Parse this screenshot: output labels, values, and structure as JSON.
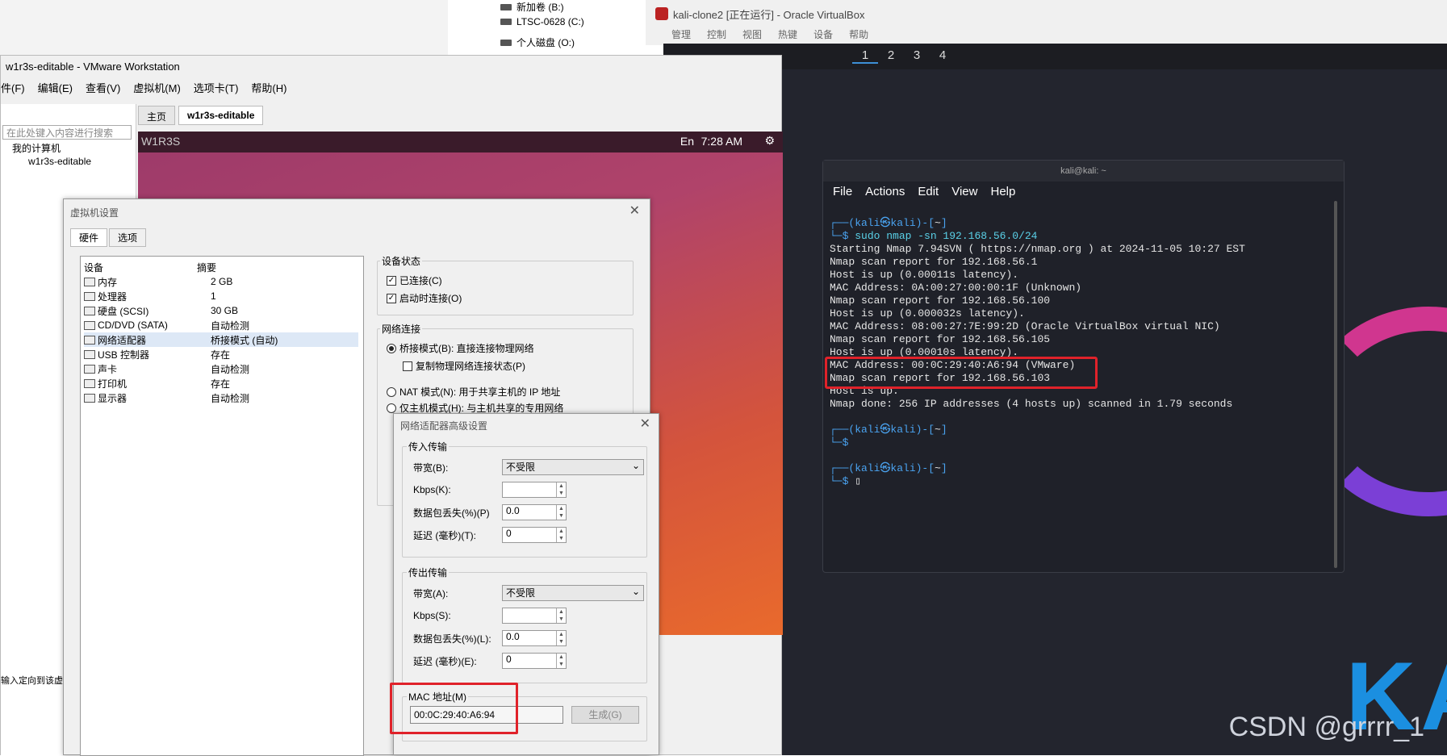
{
  "explorer": {
    "drives": [
      {
        "label": "新加卷 (B:)"
      },
      {
        "label": "LTSC-0628 (C:)"
      },
      {
        "label": "个人磁盘 (O:)"
      }
    ]
  },
  "vbox": {
    "title": "kali-clone2 [正在运行] - Oracle VirtualBox",
    "menu": [
      "管理",
      "控制",
      "视图",
      "热键",
      "设备",
      "帮助"
    ],
    "workspaces": [
      "1",
      "2",
      "3",
      "4"
    ]
  },
  "kali": {
    "logo_text": "KA",
    "watermark": "CSDN @grrrr_1"
  },
  "terminal": {
    "title": "kali@kali: ~",
    "menu": [
      "File",
      "Actions",
      "Edit",
      "View",
      "Help"
    ],
    "prompt1_user": "(kali㉿kali)",
    "prompt1_dir": "~",
    "command": "sudo nmap -sn 192.168.56.0/24",
    "output": [
      "Starting Nmap 7.94SVN ( https://nmap.org ) at 2024-11-05 10:27 EST",
      "Nmap scan report for 192.168.56.1",
      "Host is up (0.00011s latency).",
      "MAC Address: 0A:00:27:00:00:1F (Unknown)",
      "Nmap scan report for 192.168.56.100",
      "Host is up (0.000032s latency).",
      "MAC Address: 08:00:27:7E:99:2D (Oracle VirtualBox virtual NIC)",
      "Nmap scan report for 192.168.56.105",
      "Host is up (0.00010s latency).",
      "MAC Address: 00:0C:29:40:A6:94 (VMware)",
      "Nmap scan report for 192.168.56.103",
      "Host is up.",
      "Nmap done: 256 IP addresses (4 hosts up) scanned in 1.79 seconds"
    ]
  },
  "vmware": {
    "title": "w1r3s-editable - VMware Workstation",
    "menu": [
      "件(F)",
      "编辑(E)",
      "查看(V)",
      "虚拟机(M)",
      "选项卡(T)",
      "帮助(H)"
    ],
    "search_placeholder": "在此处键入内容进行搜索",
    "tree": {
      "root": "我的计算机",
      "child": "w1r3s-editable"
    },
    "tabs": {
      "home": "主页",
      "vm": "w1r3s-editable"
    },
    "guest": {
      "name": "W1R3S",
      "time": "7:28 AM",
      "lang": "En"
    },
    "side_text": "输入定向到该虚"
  },
  "settings": {
    "title": "虚拟机设置",
    "tabs": [
      "硬件",
      "选项"
    ],
    "columns": [
      "设备",
      "摘要"
    ],
    "devices": [
      {
        "name": "内存",
        "summary": "2 GB"
      },
      {
        "name": "处理器",
        "summary": "1"
      },
      {
        "name": "硬盘 (SCSI)",
        "summary": "30 GB"
      },
      {
        "name": "CD/DVD (SATA)",
        "summary": "自动检测"
      },
      {
        "name": "网络适配器",
        "summary": "桥接模式 (自动)"
      },
      {
        "name": "USB 控制器",
        "summary": "存在"
      },
      {
        "name": "声卡",
        "summary": "自动检测"
      },
      {
        "name": "打印机",
        "summary": "存在"
      },
      {
        "name": "显示器",
        "summary": "自动检测"
      }
    ],
    "device_status": {
      "label": "设备状态",
      "connected": "已连接(C)",
      "connect_on_start": "启动时连接(O)"
    },
    "network": {
      "label": "网络连接",
      "bridged": "桥接模式(B): 直接连接物理网络",
      "replicate": "复制物理网络连接状态(P)",
      "nat": "NAT 模式(N): 用于共享主机的 IP 地址",
      "hostonly": "仅主机模式(H): 与主机共享的专用网络"
    }
  },
  "advanced": {
    "title": "网络适配器高级设置",
    "incoming": {
      "label": "传入传输",
      "bandwidth_label": "带宽(B):",
      "bandwidth": "不受限",
      "kbps_label": "Kbps(K):",
      "kbps": "",
      "loss_label": "数据包丢失(%)(P)",
      "loss": "0.0",
      "latency_label": "延迟 (毫秒)(T):",
      "latency": "0"
    },
    "outgoing": {
      "label": "传出传输",
      "bandwidth_label": "带宽(A):",
      "bandwidth": "不受限",
      "kbps_label": "Kbps(S):",
      "kbps": "",
      "loss_label": "数据包丢失(%)(L):",
      "loss": "0.0",
      "latency_label": "延迟 (毫秒)(E):",
      "latency": "0"
    },
    "mac": {
      "label": "MAC 地址(M)",
      "value": "00:0C:29:40:A6:94",
      "generate": "生成(G)"
    }
  }
}
